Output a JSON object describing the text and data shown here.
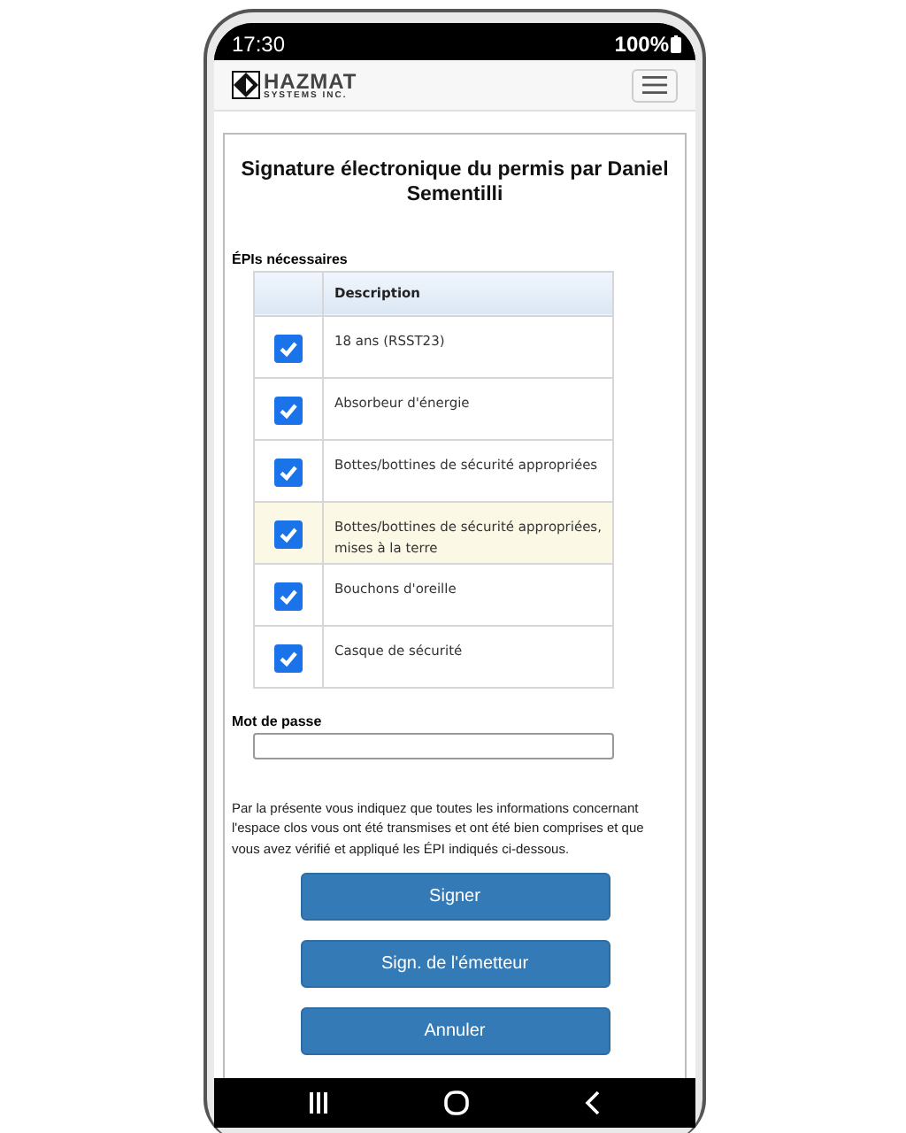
{
  "status_bar": {
    "time": "17:30",
    "battery": "100%"
  },
  "navbar": {
    "logo_title": "HAZMAT",
    "logo_subtitle": "SYSTEMS INC."
  },
  "title": "Signature électronique du permis par Daniel Sementilli",
  "ppe_section": {
    "label": "ÉPIs nécessaires",
    "columns": [
      "Description"
    ],
    "rows": [
      {
        "description": "18 ans (RSST23)",
        "checked": true,
        "highlighted": false
      },
      {
        "description": "Absorbeur d'énergie",
        "checked": true,
        "highlighted": false
      },
      {
        "description": "Bottes/bottines de sécurité appropriées",
        "checked": true,
        "highlighted": false
      },
      {
        "description": "Bottes/bottines de sécurité appropriées, mises à la terre",
        "checked": true,
        "highlighted": true
      },
      {
        "description": "Bouchons d'oreille",
        "checked": true,
        "highlighted": false
      },
      {
        "description": "Casque de sécurité",
        "checked": true,
        "highlighted": false
      }
    ]
  },
  "password": {
    "label": "Mot de passe"
  },
  "statement": "Par la présente vous indiquez que toutes les informations concernant l'espace clos vous ont été transmises et ont été bien comprises et que vous avez vérifié et appliqué les ÉPI indiqués ci-dessous.",
  "buttons": [
    "Signer",
    "Sign. de l'émetteur",
    "Annuler"
  ]
}
